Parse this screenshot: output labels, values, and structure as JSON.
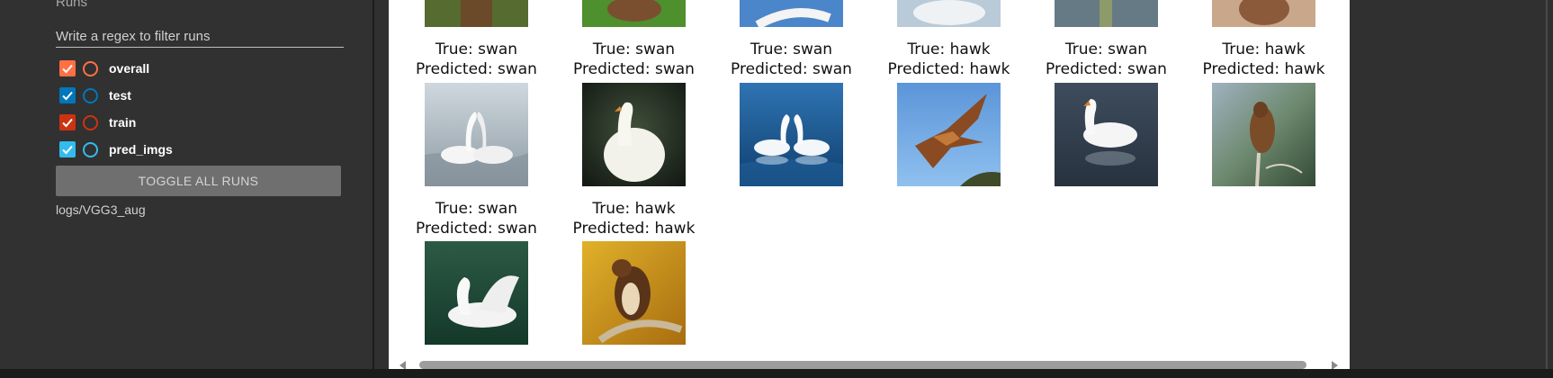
{
  "sidebar": {
    "runs_title": "Runs",
    "regex_placeholder": "Write a regex to filter runs",
    "runs": [
      {
        "label": "overall",
        "color": "#ff7043"
      },
      {
        "label": "test",
        "color": "#0077bb"
      },
      {
        "label": "train",
        "color": "#cc3311"
      },
      {
        "label": "pred_imgs",
        "color": "#33bbee"
      }
    ],
    "toggle_all_label": "TOGGLE ALL RUNS",
    "log_path": "logs/VGG3_aug"
  },
  "predictions": [
    {
      "true_text": "True: swan",
      "pred_text": "Predicted: swan",
      "subject": "swan"
    },
    {
      "true_text": "True: swan",
      "pred_text": "Predicted: swan",
      "subject": "swan"
    },
    {
      "true_text": "True: swan",
      "pred_text": "Predicted: swan",
      "subject": "swan"
    },
    {
      "true_text": "True: hawk",
      "pred_text": "Predicted: hawk",
      "subject": "hawk"
    },
    {
      "true_text": "True: swan",
      "pred_text": "Predicted: swan",
      "subject": "swan"
    },
    {
      "true_text": "True: hawk",
      "pred_text": "Predicted: hawk",
      "subject": "hawk"
    },
    {
      "true_text": "True: swan",
      "pred_text": "Predicted: swan",
      "subject": "swan"
    },
    {
      "true_text": "True: hawk",
      "pred_text": "Predicted: hawk",
      "subject": "hawk"
    }
  ]
}
